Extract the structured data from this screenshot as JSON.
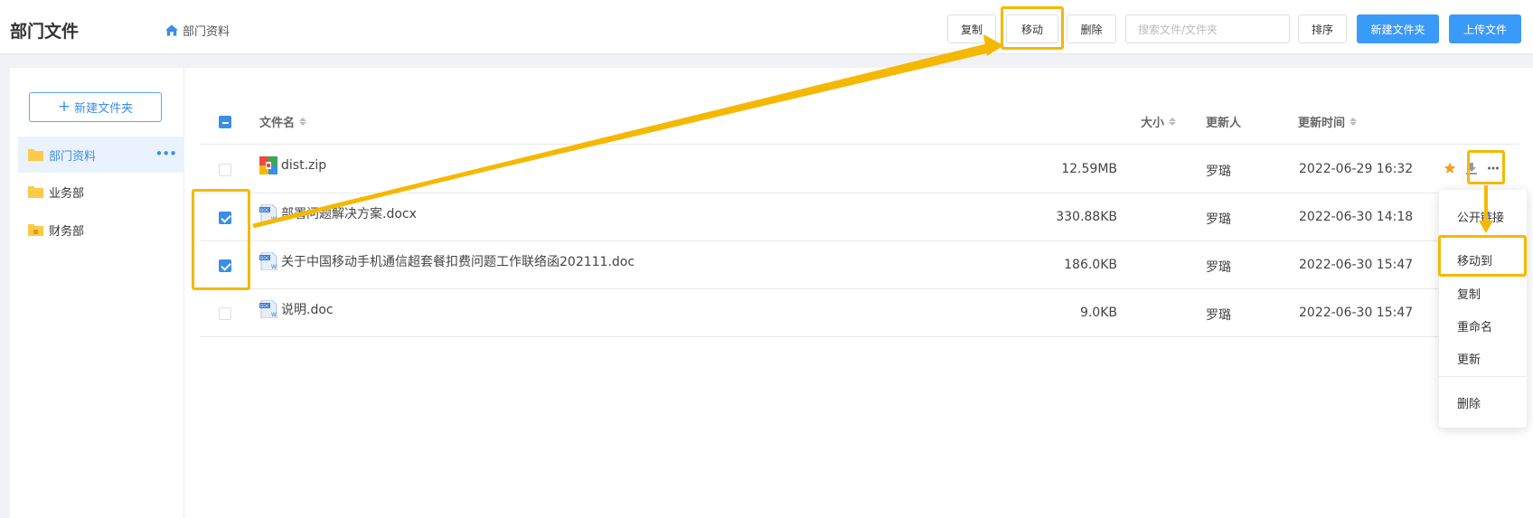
{
  "header": {
    "title": "部门文件",
    "breadcrumb": "部门资料",
    "buttons": {
      "copy": "复制",
      "move": "移动",
      "delete": "删除",
      "sort": "排序",
      "new_folder": "新建文件夹",
      "upload": "上传文件"
    },
    "search_placeholder": "搜索文件/文件夹"
  },
  "sidebar": {
    "new_folder_label": "新建文件夹",
    "items": [
      {
        "label": "部门资料",
        "active": true
      },
      {
        "label": "业务部",
        "active": false
      },
      {
        "label": "财务部",
        "active": false
      }
    ]
  },
  "table": {
    "columns": {
      "name": "文件名",
      "size": "大小",
      "updater": "更新人",
      "time": "更新时间"
    },
    "rows": [
      {
        "name": "dist.zip",
        "size": "12.59MB",
        "updater": "罗璐",
        "time": "2022-06-29 16:32",
        "checked": false,
        "type": "zip"
      },
      {
        "name": "部署问题解决方案.docx",
        "size": "330.88KB",
        "updater": "罗璐",
        "time": "2022-06-30 14:18",
        "checked": true,
        "type": "doc"
      },
      {
        "name": "关于中国移动手机通信超套餐扣费问题工作联络函202111.doc",
        "size": "186.0KB",
        "updater": "罗璐",
        "time": "2022-06-30 15:47",
        "checked": true,
        "type": "doc"
      },
      {
        "name": "说明.doc",
        "size": "9.0KB",
        "updater": "罗璐",
        "time": "2022-06-30 15:47",
        "checked": false,
        "type": "doc"
      }
    ]
  },
  "context_menu": {
    "items": [
      "公开链接",
      "移动到",
      "复制",
      "重命名",
      "更新",
      "删除"
    ]
  },
  "colors": {
    "primary": "#3a9af8",
    "highlight": "#f5b800",
    "star": "#f0a020"
  }
}
